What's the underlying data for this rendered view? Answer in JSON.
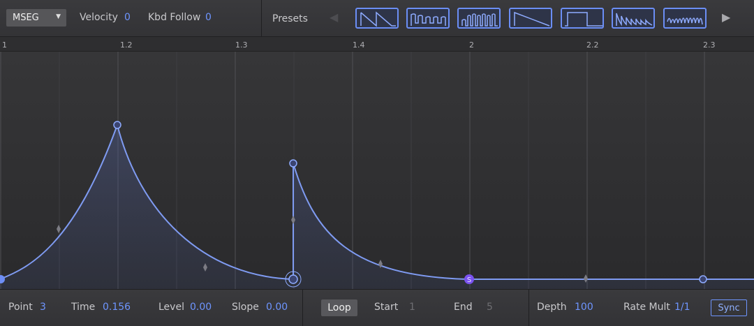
{
  "header": {
    "mode_dropdown": "MSEG",
    "velocity_label": "Velocity",
    "velocity_value": "0",
    "kbd_follow_label": "Kbd Follow",
    "kbd_follow_value": "0",
    "presets_label": "Presets"
  },
  "presets": [
    {
      "name": "saw-down-preset-icon"
    },
    {
      "name": "step-decay-preset-icon"
    },
    {
      "name": "multi-pulse-preset-icon"
    },
    {
      "name": "ramp-down-preset-icon"
    },
    {
      "name": "square-preset-icon"
    },
    {
      "name": "decay-pulses-preset-icon"
    },
    {
      "name": "bounce-preset-icon"
    }
  ],
  "ruler": {
    "ticks": [
      "1",
      "1.2",
      "1.3",
      "1.4",
      "2",
      "2.2",
      "2.3"
    ]
  },
  "footer": {
    "point_label": "Point",
    "point_value": "3",
    "time_label": "Time",
    "time_value": "0.156",
    "level_label": "Level",
    "level_value": "0.00",
    "slope_label": "Slope",
    "slope_value": "0.00",
    "loop_button": "Loop",
    "start_label": "Start",
    "start_value": "1",
    "end_label": "End",
    "end_value": "5",
    "depth_label": "Depth",
    "depth_value": "100",
    "rate_mult_label": "Rate Mult",
    "rate_mult_value": "1/1",
    "sync_button": "Sync"
  },
  "envelope": {
    "sustain_marker": "S"
  },
  "colors": {
    "accent": "#6e95ff",
    "curve": "#7f9bf2",
    "sustain": "#7a52f0",
    "background": "#2b2b2d"
  }
}
